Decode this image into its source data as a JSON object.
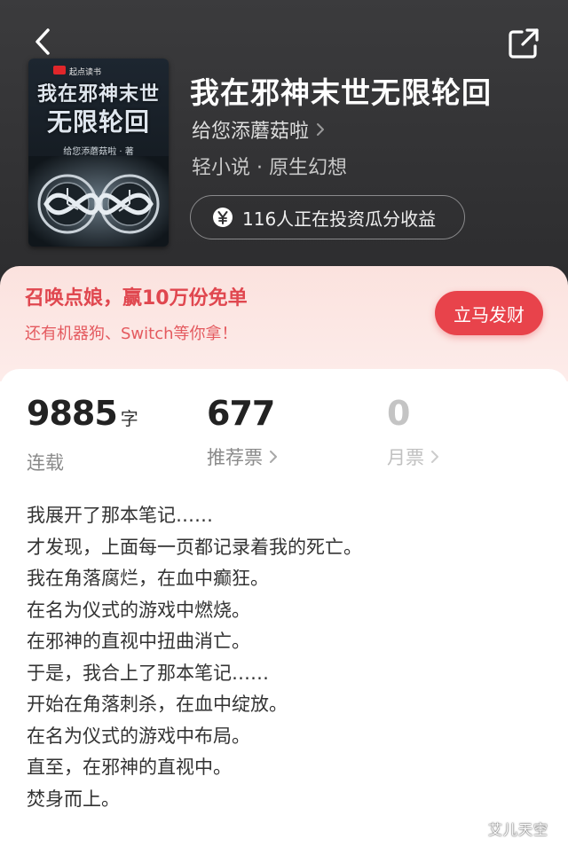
{
  "header": {
    "back_icon": "back-chevron-icon",
    "share_icon": "share-icon"
  },
  "cover": {
    "publisher": "起点读书",
    "title_line1": "我在邪神末世",
    "title_line2": "无限轮回",
    "author": "给您添蘑菇啦 · 著"
  },
  "book": {
    "title": "我在邪神末世无限轮回",
    "author": "给您添蘑菇啦",
    "genre": "轻小说 · 原生幻想",
    "invest_text": "116人正在投资瓜分收益"
  },
  "promo": {
    "title": "召唤点娘，赢10万份免单",
    "subtitle": "还有机器狗、Switch等你拿！",
    "button": "立马发财",
    "colors": {
      "accent": "#e8434b",
      "background": "#fbe2de"
    }
  },
  "stats": [
    {
      "value": "9885",
      "unit": "字",
      "label": "连载"
    },
    {
      "value": "677",
      "label": "推荐票"
    },
    {
      "value": "0",
      "label": "月票"
    }
  ],
  "synopsis": [
    "我展开了那本笔记……",
    "才发现，上面每一页都记录着我的死亡。",
    "我在角落腐烂，在血中癫狂。",
    "在名为仪式的游戏中燃烧。",
    "在邪神的直视中扭曲消亡。",
    "于是，我合上了那本笔记……",
    "开始在角落刺杀，在血中绽放。",
    "在名为仪式的游戏中布局。",
    "直至，在邪神的直视中。",
    "焚身而上。"
  ],
  "watermark": "艾儿天空"
}
